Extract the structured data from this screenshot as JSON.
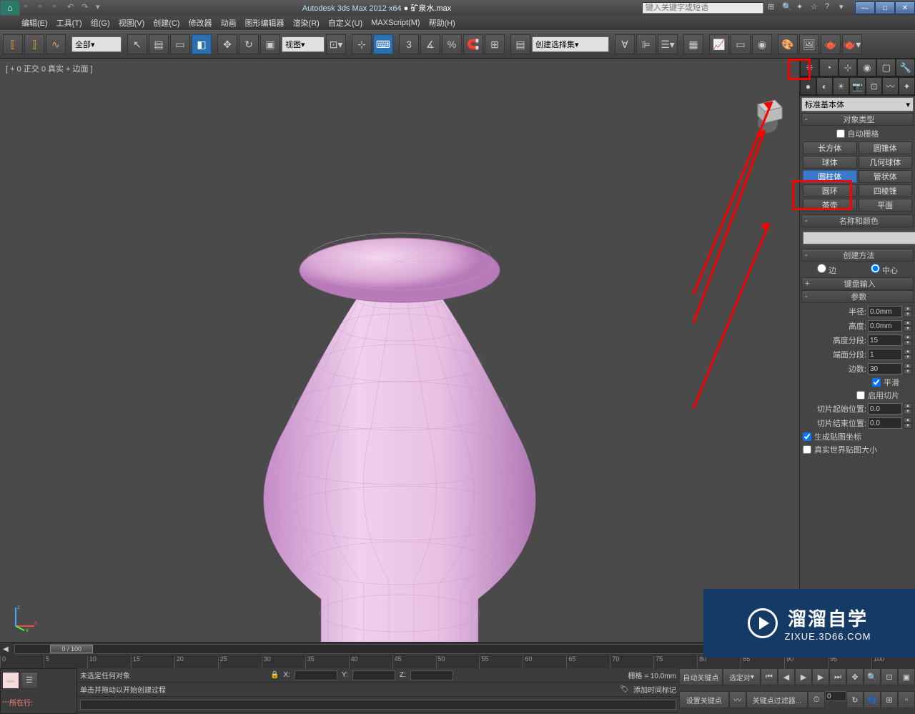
{
  "title": {
    "app": "Autodesk 3ds Max  2012 x64",
    "file": "矿泉水.max",
    "search_placeholder": "键入关键字或短语"
  },
  "menubar": [
    "编辑(E)",
    "工具(T)",
    "组(G)",
    "视图(V)",
    "创建(C)",
    "修改器",
    "动画",
    "图形编辑器",
    "渲染(R)",
    "自定义(U)",
    "MAXScript(M)",
    "帮助(H)"
  ],
  "toolbar": {
    "layer_dropdown": "全部",
    "view_dropdown": "视图",
    "selset_dropdown": "创建选择集"
  },
  "viewport": {
    "label": "[ + 0 正交 0 真实 + 边面  ]"
  },
  "cmdpanel": {
    "geom_dropdown": "标准基本体",
    "rollouts": {
      "object_type": "对象类型",
      "auto_grid": "自动栅格",
      "name_color": "名称和颜色",
      "create_method": "创建方法",
      "keyboard_entry": "键盘输入",
      "parameters": "参数"
    },
    "objects": {
      "box": "长方体",
      "cone": "圆锥体",
      "sphere": "球体",
      "geosphere": "几何球体",
      "cylinder": "圆柱体",
      "tube": "管状体",
      "torus": "圆环",
      "pyramid": "四棱锥",
      "teapot": "茶壶",
      "plane": "平面"
    },
    "create_method_opts": {
      "edge": "边",
      "center": "中心"
    },
    "params": {
      "radius_lbl": "半径:",
      "radius_val": "0.0mm",
      "height_lbl": "高度:",
      "height_val": "0.0mm",
      "hseg_lbl": "高度分段:",
      "hseg_val": "15",
      "cseg_lbl": "端面分段:",
      "cseg_val": "1",
      "sides_lbl": "边数:",
      "sides_val": "30",
      "smooth": "平滑",
      "slice_on": "启用切片",
      "slice_from_lbl": "切片起始位置:",
      "slice_from_val": "0.0",
      "slice_to_lbl": "切片结束位置:",
      "slice_to_val": "0.0",
      "gen_mapping": "生成贴图坐标",
      "real_world": "真实世界贴图大小"
    }
  },
  "timeline": {
    "pos": "0 / 100",
    "ticks": [
      "0",
      "5",
      "10",
      "15",
      "20",
      "25",
      "30",
      "35",
      "40",
      "45",
      "50",
      "55",
      "60",
      "65",
      "70",
      "75",
      "80",
      "85",
      "90",
      "95",
      "100"
    ]
  },
  "status": {
    "row_label": "所在行:",
    "no_selection": "未选定任何对象",
    "hint": "单击并拖动以开始创建过程",
    "grid": "栅格 = 10.0mm",
    "add_time_tag": "添加时间标记",
    "auto_key": "自动关键点",
    "set_key": "设置关键点",
    "selected": "选定对",
    "key_filter": "关键点过滤器...",
    "x": "X:",
    "y": "Y:",
    "z": "Z:"
  },
  "watermark": {
    "big": "溜溜自学",
    "small": "ZIXUE.3D66.COM"
  },
  "icons": {
    "minimize": "—",
    "maximize": "□",
    "close": "✕"
  }
}
